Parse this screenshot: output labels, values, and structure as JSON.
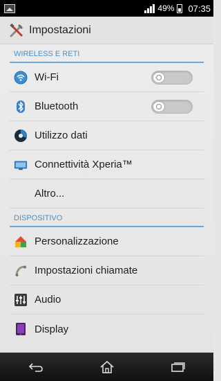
{
  "status_bar": {
    "battery": "49%",
    "time": "07:35"
  },
  "action_bar": {
    "title": "Impostazioni",
    "icon": "settings-tools-icon"
  },
  "sections": [
    {
      "header": "WIRELESS E RETI",
      "items": [
        {
          "label": "Wi-Fi",
          "icon": "wifi-icon",
          "toggle": false
        },
        {
          "label": "Bluetooth",
          "icon": "bluetooth-icon",
          "toggle": false
        },
        {
          "label": "Utilizzo dati",
          "icon": "data-usage-icon"
        },
        {
          "label": "Connettività Xperia™",
          "icon": "xperia-connectivity-icon"
        },
        {
          "label": "Altro...",
          "icon": ""
        }
      ]
    },
    {
      "header": "DISPOSITIVO",
      "items": [
        {
          "label": "Personalizzazione",
          "icon": "personalization-icon"
        },
        {
          "label": "Impostazioni chiamate",
          "icon": "phone-icon"
        },
        {
          "label": "Audio",
          "icon": "audio-equalizer-icon"
        },
        {
          "label": "Display",
          "icon": "display-icon"
        }
      ]
    }
  ],
  "nav_bar": {
    "buttons": [
      "back-icon",
      "home-icon",
      "recent-apps-icon"
    ]
  },
  "colors": {
    "accent": "#4a90c8",
    "background": "#e6e6e6",
    "status_bar": "#000000"
  }
}
